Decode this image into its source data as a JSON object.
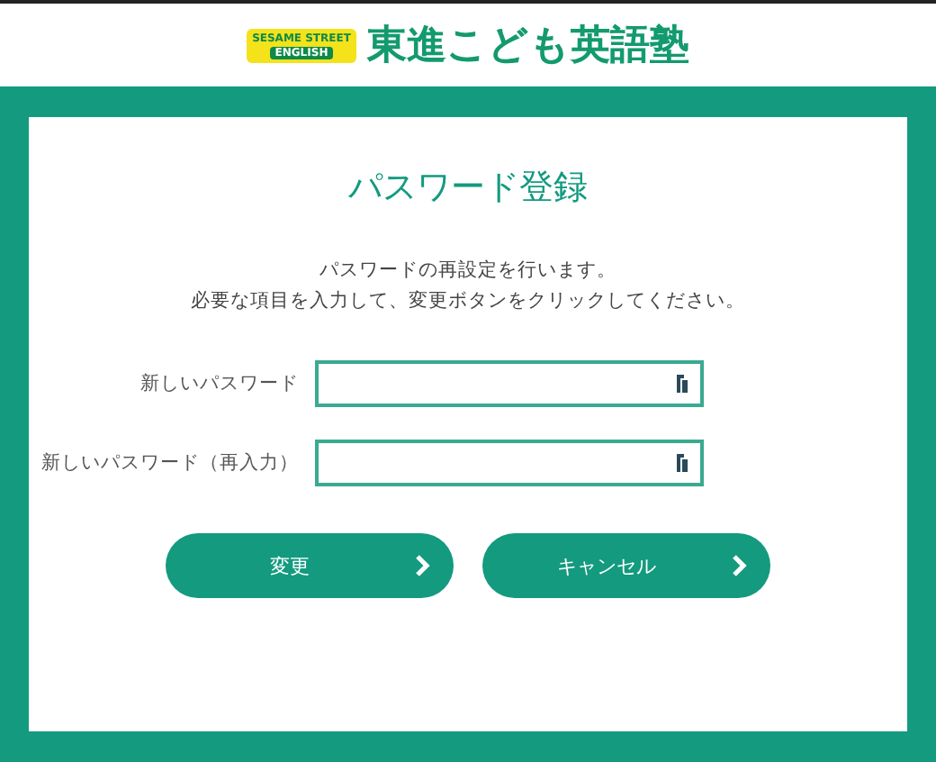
{
  "header": {
    "logo_badge": [
      "SESAME STREET",
      "ENGLISH"
    ],
    "brand": "東進こども英語塾"
  },
  "title": "パスワード登録",
  "description": [
    "パスワードの再設定を行います。",
    "必要な項目を入力して、変更ボタンをクリックしてください。"
  ],
  "fields": [
    {
      "label": "新しいパスワード"
    },
    {
      "label": "新しいパスワード（再入力）"
    }
  ],
  "buttons": [
    "変更",
    "キャンセル"
  ]
}
